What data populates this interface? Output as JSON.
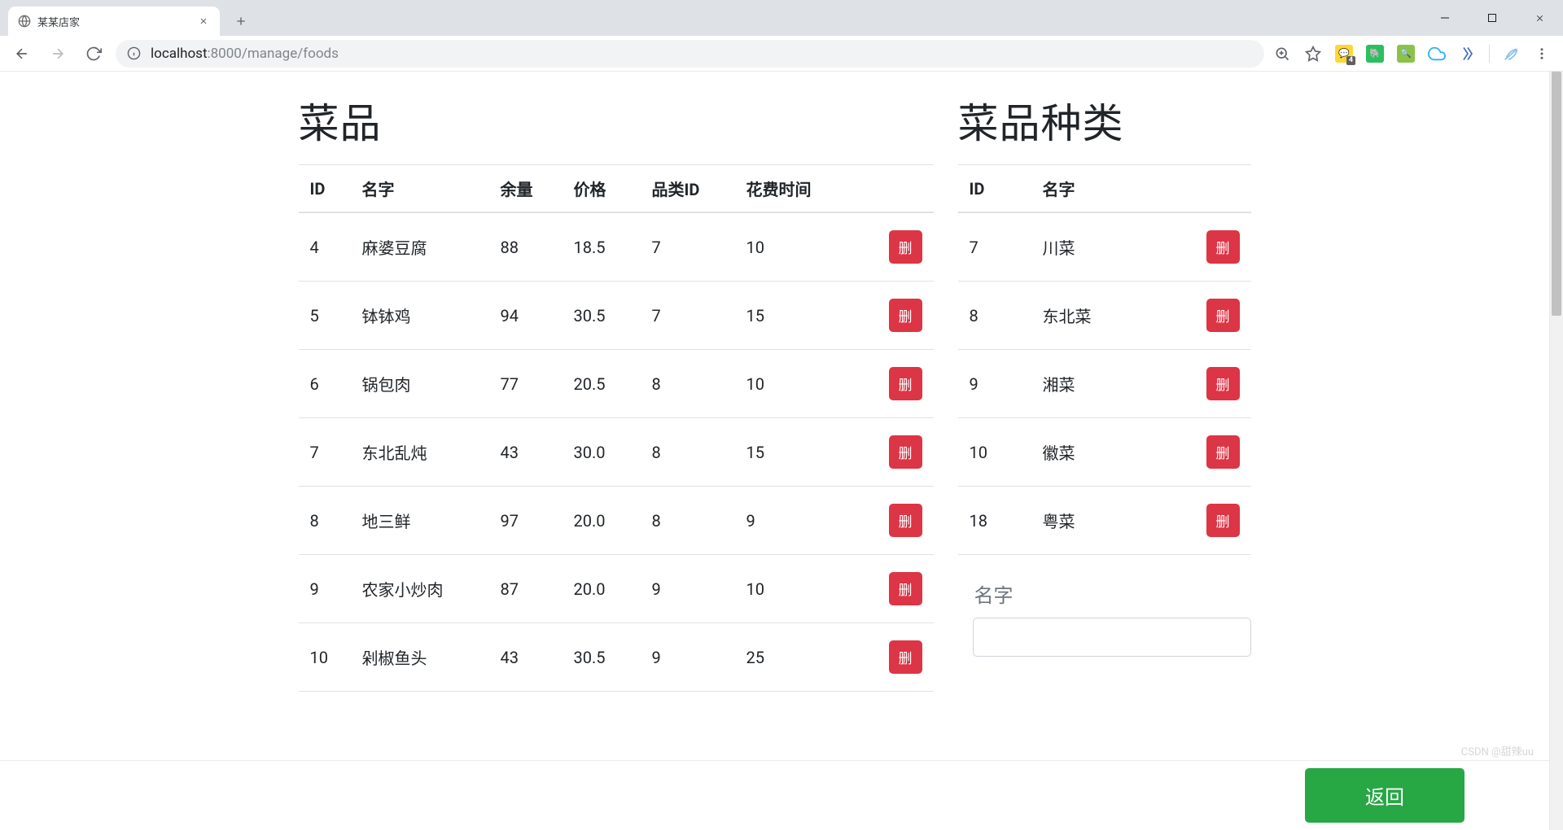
{
  "browser": {
    "tab_title": "某某店家",
    "url_host_strong": "localhost",
    "url_host_weak": ":8000/manage/foods",
    "ext_badge": "4"
  },
  "left": {
    "title": "菜品",
    "headers": {
      "id": "ID",
      "name": "名字",
      "stock": "余量",
      "price": "价格",
      "cat": "品类ID",
      "time": "花费时间"
    },
    "delete_label": "删",
    "rows": [
      {
        "id": "4",
        "name": "麻婆豆腐",
        "stock": "88",
        "price": "18.5",
        "cat": "7",
        "time": "10"
      },
      {
        "id": "5",
        "name": "钵钵鸡",
        "stock": "94",
        "price": "30.5",
        "cat": "7",
        "time": "15"
      },
      {
        "id": "6",
        "name": "锅包肉",
        "stock": "77",
        "price": "20.5",
        "cat": "8",
        "time": "10"
      },
      {
        "id": "7",
        "name": "东北乱炖",
        "stock": "43",
        "price": "30.0",
        "cat": "8",
        "time": "15"
      },
      {
        "id": "8",
        "name": "地三鲜",
        "stock": "97",
        "price": "20.0",
        "cat": "8",
        "time": "9"
      },
      {
        "id": "9",
        "name": "农家小炒肉",
        "stock": "87",
        "price": "20.0",
        "cat": "9",
        "time": "10"
      },
      {
        "id": "10",
        "name": "剁椒鱼头",
        "stock": "43",
        "price": "30.5",
        "cat": "9",
        "time": "25"
      }
    ]
  },
  "right": {
    "title": "菜品种类",
    "headers": {
      "id": "ID",
      "name": "名字"
    },
    "delete_label": "删",
    "rows": [
      {
        "id": "7",
        "name": "川菜"
      },
      {
        "id": "8",
        "name": "东北菜"
      },
      {
        "id": "9",
        "name": "湘菜"
      },
      {
        "id": "10",
        "name": "徽菜"
      },
      {
        "id": "18",
        "name": "粤菜"
      }
    ],
    "form": {
      "label": "名字",
      "placeholder": ""
    }
  },
  "bottom": {
    "back_label": "返回"
  },
  "watermark": "CSDN @甜辣uu"
}
